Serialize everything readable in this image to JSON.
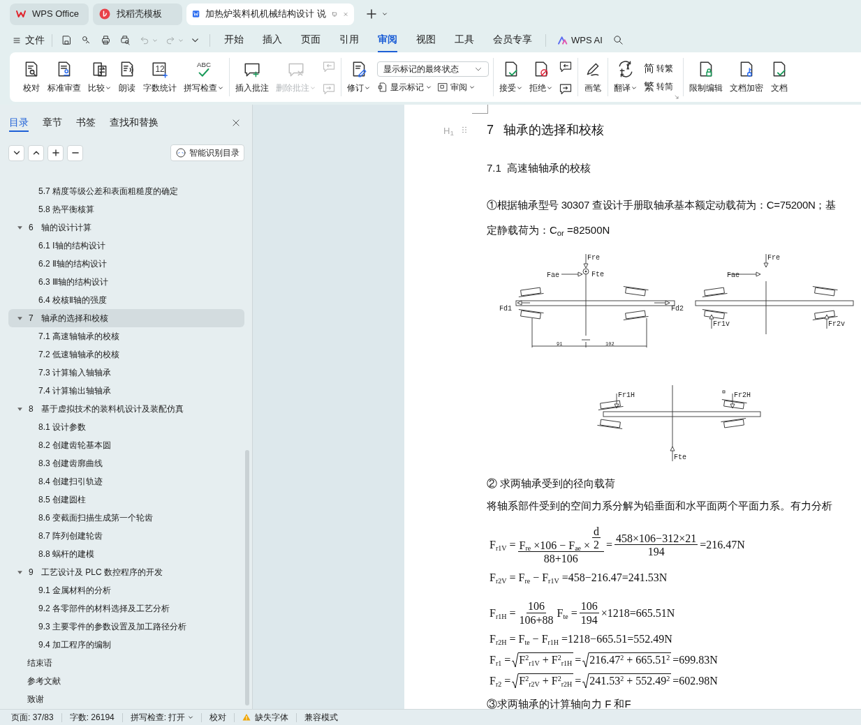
{
  "title_tabs": [
    {
      "label": "WPS Office",
      "selected": false
    },
    {
      "label": "找稻壳模板",
      "selected": false
    },
    {
      "label": "加热炉装料机机械结构设计 说",
      "selected": true
    }
  ],
  "menu": {
    "file": "文件",
    "tabs": [
      {
        "label": "开始",
        "selected": false
      },
      {
        "label": "插入",
        "selected": false
      },
      {
        "label": "页面",
        "selected": false
      },
      {
        "label": "引用",
        "selected": false
      },
      {
        "label": "审阅",
        "selected": true
      },
      {
        "label": "视图",
        "selected": false
      },
      {
        "label": "工具",
        "selected": false
      },
      {
        "label": "会员专享",
        "selected": false
      }
    ],
    "ai": "WPS AI"
  },
  "ribbon": [
    [
      {
        "kind": "large",
        "label": "校对",
        "dropdown": false,
        "disabled": false
      },
      {
        "kind": "large",
        "label": "标准审查",
        "dropdown": false,
        "disabled": false
      },
      {
        "kind": "large",
        "label": "比较",
        "dropdown": true,
        "disabled": false
      },
      {
        "kind": "large",
        "label": "朗读",
        "dropdown": false,
        "disabled": false
      },
      {
        "kind": "large",
        "label": "字数统计",
        "dropdown": false,
        "disabled": false,
        "icon_text": "12"
      },
      {
        "kind": "large",
        "label": "拼写检查",
        "dropdown": true,
        "disabled": false,
        "icon_text": "ABC"
      }
    ],
    [
      {
        "kind": "large",
        "label": "插入批注",
        "dropdown": false,
        "disabled": false
      },
      {
        "kind": "large",
        "label": "删除批注",
        "dropdown": true,
        "disabled": true
      },
      {
        "kind": "icon_stack",
        "disabled": true
      }
    ],
    [
      {
        "kind": "large",
        "label": "修订",
        "dropdown": true,
        "disabled": false
      },
      {
        "kind": "select_stack",
        "value": "显示标记的最终状态",
        "buttons": [
          {
            "label": "显示标记",
            "dropdown": true
          },
          {
            "label": "审阅",
            "dropdown": true
          }
        ]
      }
    ],
    [
      {
        "kind": "large",
        "label": "接受",
        "dropdown": true,
        "disabled": false
      },
      {
        "kind": "large",
        "label": "拒绝",
        "dropdown": true,
        "disabled": false
      },
      {
        "kind": "icon_stack",
        "disabled": false
      }
    ],
    [
      {
        "kind": "large",
        "label": "画笔",
        "dropdown": false,
        "disabled": false
      }
    ],
    [
      {
        "kind": "large",
        "label": "翻译",
        "dropdown": true,
        "disabled": false
      },
      {
        "kind": "small_stack",
        "buttons": [
          {
            "label": "转繁",
            "icon_text": "简"
          },
          {
            "label": "转简",
            "icon_text": "繁"
          }
        ]
      }
    ],
    [
      {
        "kind": "large",
        "label": "限制编辑",
        "dropdown": false,
        "disabled": false
      },
      {
        "kind": "large",
        "label": "文档加密",
        "dropdown": false,
        "disabled": false
      },
      {
        "kind": "large",
        "label": "文档",
        "dropdown": false,
        "disabled": false
      }
    ]
  ],
  "sidebar": {
    "tabs": [
      {
        "label": "目录",
        "selected": true
      },
      {
        "label": "章节",
        "selected": false
      },
      {
        "label": "书签",
        "selected": false
      },
      {
        "label": "查找和替换",
        "selected": false
      }
    ],
    "smart_button": "智能识别目录",
    "toc_continued": [
      {
        "label": "5.7 精度等级公差和表面粗糙度的确定",
        "selected": false
      },
      {
        "label": "5.8 热平衡核算",
        "selected": false
      }
    ],
    "toc": [
      {
        "number": "6",
        "title": "轴的设计计算",
        "expanded": true,
        "selected": false,
        "children": [
          {
            "label": "6.1 Ⅰ轴的结构设计",
            "selected": false
          },
          {
            "label": "6.2 Ⅱ轴的结构设计",
            "selected": false
          },
          {
            "label": "6.3 Ⅲ轴的结构设计",
            "selected": false
          },
          {
            "label": "6.4 校核Ⅱ轴的强度",
            "selected": false
          }
        ]
      },
      {
        "number": "7",
        "title": "轴承的选择和校核",
        "expanded": true,
        "selected": true,
        "children": [
          {
            "label": "7.1 高速轴轴承的校核",
            "selected": false
          },
          {
            "label": "7.2 低速轴轴承的校核",
            "selected": false
          },
          {
            "label": "7.3 计算输入轴轴承",
            "selected": false
          },
          {
            "label": "7.4 计算输出轴轴承",
            "selected": false
          }
        ]
      },
      {
        "number": "8",
        "title": "基于虚拟技术的装料机设计及装配仿真",
        "expanded": true,
        "selected": false,
        "children": [
          {
            "label": "8.1 设计参数",
            "selected": false
          },
          {
            "label": "8.2 创建齿轮基本圆",
            "selected": false
          },
          {
            "label": "8.3 创建齿廓曲线",
            "selected": false
          },
          {
            "label": "8.4 创建扫引轨迹",
            "selected": false
          },
          {
            "label": "8.5 创建圆柱",
            "selected": false
          },
          {
            "label": "8.6 变截面扫描生成第一个轮齿",
            "selected": false
          },
          {
            "label": "8.7 阵列创建轮齿",
            "selected": false
          },
          {
            "label": "8.8 蜗杆的建模",
            "selected": false
          }
        ]
      },
      {
        "number": "9",
        "title": "工艺设计及 PLC 数控程序的开发",
        "expanded": true,
        "selected": false,
        "children": [
          {
            "label": "9.1 金属材料的分析",
            "selected": false
          },
          {
            "label": "9.2 各零部件的材料选择及工艺分析",
            "selected": false
          },
          {
            "label": "9.3 主要零件的参数设置及加工路径分析",
            "selected": false
          },
          {
            "label": "9.4 加工程序的编制",
            "selected": false
          }
        ]
      }
    ],
    "toc_end": [
      {
        "label": "结束语",
        "selected": false
      },
      {
        "label": "参考文献",
        "selected": false
      },
      {
        "label": "致谢",
        "selected": false
      }
    ]
  },
  "document": {
    "heading_marker": "H$_{1}$",
    "heading": {
      "number": "7",
      "title": "轴承的选择和校核"
    },
    "subheading": {
      "number": "7.1",
      "title": "高速轴轴承的校核"
    },
    "paragraph_1": "①根据轴承型号 30307 查设计手册取轴承基本额定动载荷为：C=75200N；基",
    "paragraph_1_cont": "定静载荷为：C$_{or}$ =82500N",
    "diagrams": [
      {
        "labels": [
          "Fre",
          "Fae",
          "Fte",
          "Fd1",
          "Fd2",
          "91",
          "102"
        ]
      },
      {
        "labels": [
          "Fre",
          "Fae",
          "Fr1v",
          "Fr2v"
        ]
      },
      {
        "labels": [
          "Fr1H",
          "Fr2H",
          "Fte"
        ]
      }
    ],
    "step_2": "② 求两轴承受到的径向载荷",
    "paragraph_2": "将轴系部件受到的空间力系分解为铅垂面和水平面两个平面力系。有力分析",
    "equations": [
      [
        {
          "kind": "text",
          "text": "F$_{r1V}$ ="
        },
        {
          "kind": "frac",
          "num": [
            {
              "kind": "text",
              "text": "F$_{re}$ ×106 − F$_{ae}$ ×"
            },
            {
              "kind": "frac",
              "num": [
                {
                  "kind": "text",
                  "text": "d"
                }
              ],
              "den": [
                {
                  "kind": "text",
                  "text": "2"
                }
              ]
            }
          ],
          "den": [
            {
              "kind": "text",
              "text": "88+106"
            }
          ]
        },
        {
          "kind": "text",
          "text": "="
        },
        {
          "kind": "frac",
          "num": [
            {
              "kind": "text",
              "text": "458×106−312×21"
            }
          ],
          "den": [
            {
              "kind": "text",
              "text": "194"
            }
          ]
        },
        {
          "kind": "text",
          "text": "=216.47N"
        }
      ],
      [
        {
          "kind": "text",
          "text": "F$_{r2V}$ = F$_{re}$ − F$_{r1V}$ =458−216.47=241.53N"
        }
      ],
      [
        {
          "kind": "text",
          "text": "F$_{r1H}$ ="
        },
        {
          "kind": "frac",
          "num": [
            {
              "kind": "text",
              "text": "106"
            }
          ],
          "den": [
            {
              "kind": "text",
              "text": "106+88"
            }
          ]
        },
        {
          "kind": "text",
          "text": "F$_{te}$ ="
        },
        {
          "kind": "frac",
          "num": [
            {
              "kind": "text",
              "text": "106"
            }
          ],
          "den": [
            {
              "kind": "text",
              "text": "194"
            }
          ]
        },
        {
          "kind": "text",
          "text": "×1218=665.51N"
        }
      ],
      [
        {
          "kind": "text",
          "text": "F$_{r2H}$ = F$_{te}$ − F$_{r1H}$ =1218−665.51=552.49N"
        }
      ],
      [
        {
          "kind": "text",
          "text": "F$_{r1}$ ="
        },
        {
          "kind": "sqrt",
          "body": [
            {
              "kind": "text",
              "text": "F$^{2}$$_{r1V}$ + F$^{2}$$_{r1H}$"
            }
          ]
        },
        {
          "kind": "text",
          "text": "="
        },
        {
          "kind": "sqrt",
          "body": [
            {
              "kind": "text",
              "text": "216.47$^{2}$ + 665.51$^{2}$"
            }
          ]
        },
        {
          "kind": "text",
          "text": "=699.83N"
        }
      ],
      [
        {
          "kind": "text",
          "text": "F$_{r2}$ ="
        },
        {
          "kind": "sqrt",
          "body": [
            {
              "kind": "text",
              "text": "F$^{2}$$_{r2V}$ + F$^{2}$$_{r2H}$"
            }
          ]
        },
        {
          "kind": "text",
          "text": "="
        },
        {
          "kind": "sqrt",
          "body": [
            {
              "kind": "text",
              "text": "241.53$^{2}$ + 552.49$^{2}$"
            }
          ]
        },
        {
          "kind": "text",
          "text": "=602.98N"
        }
      ]
    ],
    "step_3": "③求两轴承的计算轴向力 F 和F"
  },
  "status_bar": [
    {
      "kind": "text",
      "text": "页面: 37/83"
    },
    {
      "kind": "text",
      "text": "字数: 26194"
    },
    {
      "kind": "dropdown",
      "text": "拼写检查: 打开"
    },
    {
      "kind": "text",
      "text": "校对"
    },
    {
      "kind": "warning",
      "text": "缺失字体"
    },
    {
      "kind": "text",
      "text": "兼容模式"
    }
  ]
}
